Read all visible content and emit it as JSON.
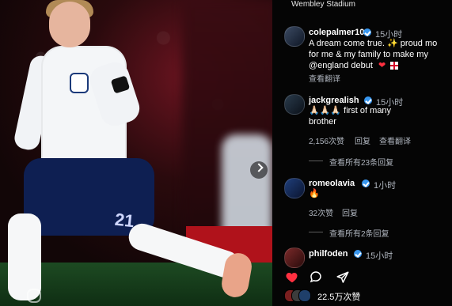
{
  "location": {
    "name": "Wembley Stadium"
  },
  "post": {
    "author": "colepalmer10",
    "time": "15小时",
    "caption_line1": "A dream come true. ✨ proud mo",
    "caption_line2": "for me & my family to make my",
    "caption_line3": "@england debut",
    "translate": "查看翻译"
  },
  "comments": [
    {
      "user": "jackgrealish",
      "time": "15小时",
      "text_line1": "🙏🏻🙏🏻🙏🏻 first of many",
      "text_line2": "brother",
      "likes": "2,156次赞",
      "reply": "回复",
      "translate": "查看翻译",
      "view_replies": "查看所有23条回复"
    },
    {
      "user": "romeolavia",
      "time": "1小时",
      "text_line1": "🔥",
      "likes": "32次赞",
      "reply": "回复",
      "view_replies": "查看所有2条回复"
    },
    {
      "user": "philfoden",
      "time": "15小时"
    }
  ],
  "footer": {
    "likes_count": "22.5万次赞"
  },
  "icons": {
    "heart": "heart-icon",
    "comment": "comment-icon",
    "share": "share-icon",
    "verified": "verified-badge-icon",
    "next": "chevron-right-icon"
  },
  "colors": {
    "panel_bg": "#050505",
    "muted": "#aeb4bd",
    "heart": "#ff3040",
    "verified": "#3897f0"
  }
}
